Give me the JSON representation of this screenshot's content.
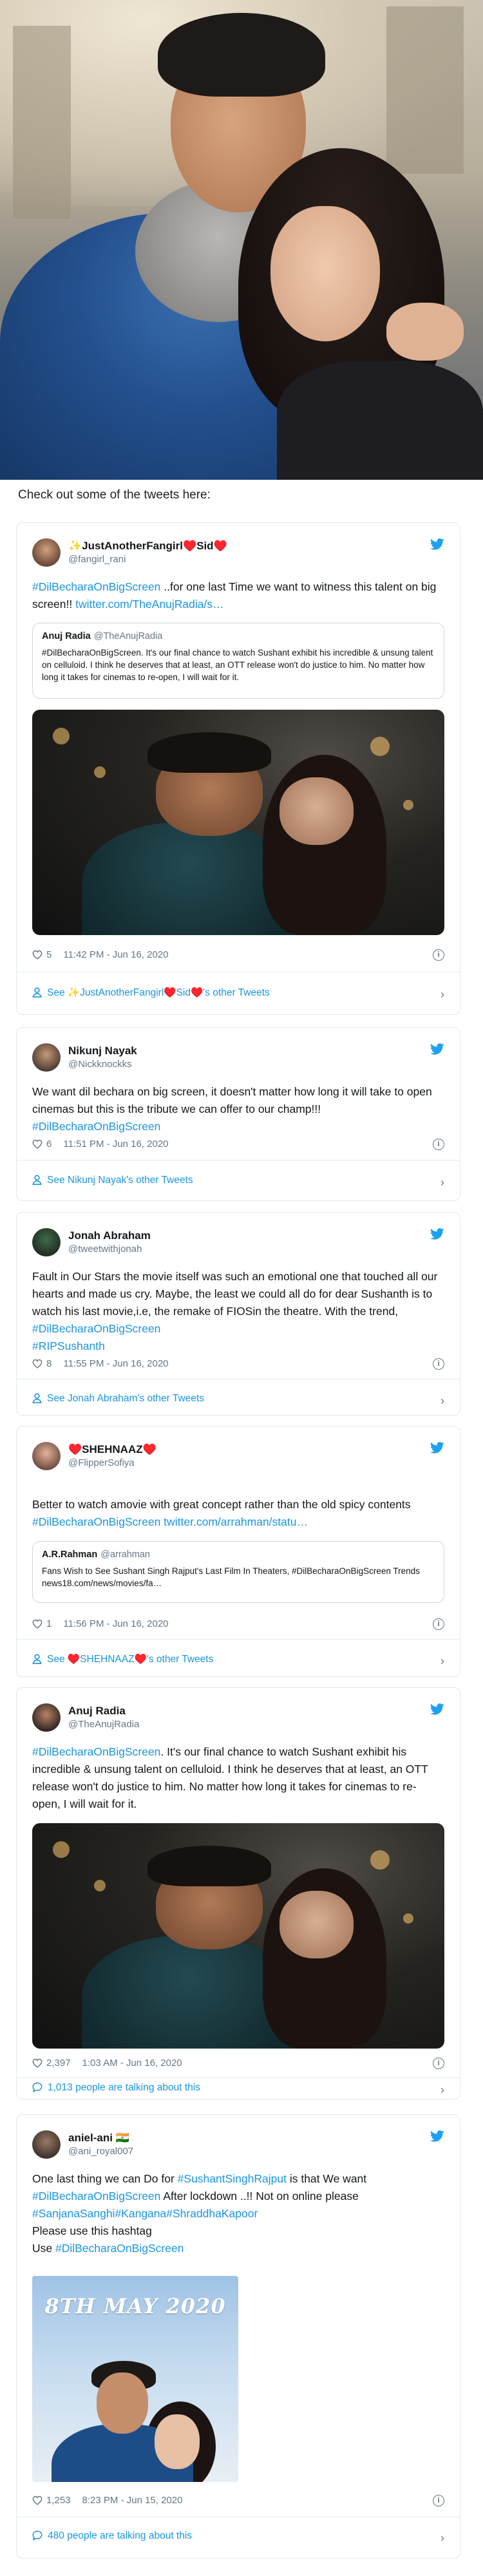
{
  "intro": "Check out some of the tweets here:",
  "colors": {
    "link": "#1b95e0",
    "muted": "#657786",
    "heart": "#e0245e",
    "twitter": "#1da1f2",
    "border": "#e1e8ed"
  },
  "icons": {
    "brand": "twitter-bird-icon",
    "like": "heart-icon",
    "profile": "person-icon",
    "reply": "speech-bubble-icon",
    "info": "info-icon",
    "arrow": "chevron-right-icon"
  },
  "tweets": [
    {
      "name": "✨JustAnotherFangirl♥️Sid♥️",
      "handle": "@fangirl_rani",
      "text_hashtag": "#DilBecharaOnBigScreen",
      "text_rest": " ..for one last Time we want to witness this talent on big screen!! ",
      "text_link": "twitter.com/TheAnujRadia/s…",
      "quote_name": "Anuj Radia",
      "quote_handle": "@TheAnujRadia",
      "quote_text": "#DilBecharaOnBigScreen. It's our final chance to watch Sushant exhibit his incredible & unsung talent on celluloid. I think he deserves that at least, an OTT release won't do justice to him. No matter how long it takes for cinemas to re-open, I will wait for it.",
      "likes": "5",
      "time": "11:42 PM - Jun 16, 2020",
      "footer": "See ✨JustAnotherFangirl♥️Sid♥️'s other Tweets"
    },
    {
      "name": "Nikunj Nayak",
      "handle": "@Nickknockks",
      "text_plain": "We want dil bechara on big screen, it doesn't matter how long it will take to open cinemas but this is the tribute we can offer to our champ!!!",
      "text_hashtag": "#DilBecharaOnBigScreen",
      "likes": "6",
      "time": "11:51 PM - Jun 16, 2020",
      "footer": "See Nikunj Nayak's other Tweets"
    },
    {
      "name": "Jonah Abraham",
      "handle": "@tweetwithjonah",
      "text_plain": "Fault in Our Stars the movie itself was such an emotional one that touched all our hearts and made us cry. Maybe, the least we could all do for dear Sushanth is to watch his last movie,i.e, the remake of FIOSin the theatre. With the trend, ",
      "text_hashtag": "#DilBecharaOnBigScreen",
      "text_hashtag2": "#RIPSushanth",
      "likes": "8",
      "time": "11:55 PM - Jun 16, 2020",
      "footer": "See Jonah Abraham's other Tweets"
    },
    {
      "name": "♥️SHEHNAAZ♥️",
      "handle": "@FlipperSofiya",
      "text_plain": "Better to watch amovie with great concept rather than the old spicy contents",
      "text_hashtag": "#DilBecharaOnBigScreen",
      "text_link": " twitter.com/arrahman/statu…",
      "quote_name": "A.R.Rahman",
      "quote_handle": "@arrahman",
      "quote_text": "Fans Wish to See Sushant Singh Rajput's Last Film In Theaters, #DilBecharaOnBigScreen Trends news18.com/news/movies/fa…",
      "likes": "1",
      "time": "11:56 PM - Jun 16, 2020",
      "footer": "See ♥️SHEHNAAZ♥️'s other Tweets"
    },
    {
      "name": "Anuj Radia",
      "handle": "@TheAnujRadia",
      "text_hashtag": "#DilBecharaOnBigScreen",
      "text_rest": ". It's our final chance to watch Sushant exhibit his incredible & unsung talent on celluloid. I think he deserves that at least, an OTT release won't do justice to him. No matter how long it takes for cinemas to re-open, I will wait for it.",
      "likes": "2,397",
      "time": "1:03 AM - Jun 16, 2020",
      "footer": "1,013 people are talking about this"
    },
    {
      "name": "aniel-ani 🇮🇳",
      "handle": "@ani_royal007",
      "line1_plain": "One last thing we can Do for ",
      "line1_tag": "#SushantSinghRajput",
      "line1_rest": " is that We want",
      "line2_tag": "#DilBecharaOnBigScreen",
      "line2_rest": " After lockdown ..!! Not on online please",
      "line3_tags": "#SanjanaSanghi#Kangana#ShraddhaKapoor",
      "line4": "Please use this hashtag",
      "line5_plain": "Use ",
      "line5_tag": "#DilBecharaOnBigScreen",
      "poster_title": "8TH MAY 2020",
      "likes": "1,253",
      "time": "8:23 PM - Jun 15, 2020",
      "footer": "480 people are talking about this"
    }
  ]
}
